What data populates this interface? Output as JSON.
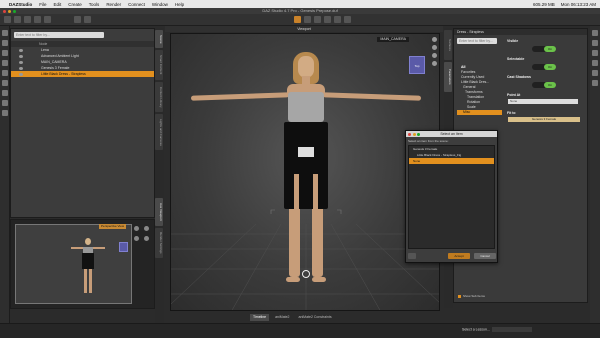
{
  "menubar": {
    "app": "DAZStudio",
    "items": [
      "File",
      "Edit",
      "Create",
      "Tools",
      "Render",
      "Connect",
      "Window",
      "Help"
    ],
    "right_status": [
      "605.29 MB",
      "Mon 06:13:23 AM"
    ]
  },
  "window": {
    "title": "DAZ Studio 4.7 Pro - Genesis Prepose.duf"
  },
  "scene": {
    "filter_placeholder": "Enter text to filter by...",
    "column": "Node",
    "nodes": [
      "Lena",
      "Advanced Ambient Light",
      "MAIN_CAMERA",
      "Genesis 3 Female",
      "Little Black Dress - Strapless"
    ],
    "selected_index": 4
  },
  "left_tabs": [
    "Scene",
    "Smart Content",
    "Content Library",
    "Lights and Cameras"
  ],
  "aux": {
    "label": "Perspective View"
  },
  "aux_tabs": [
    "Aux Viewport",
    "Render Settings"
  ],
  "viewport": {
    "title": "Viewport",
    "camera": "MAIN_CAMERA",
    "cube_label": "Top"
  },
  "right_tabs": [
    "Surfaces",
    "Parameters"
  ],
  "params": {
    "header": "Dress - Strapless",
    "filter_placeholder": "Enter text to filter by...",
    "list": [
      "All",
      "Favorites",
      "Currently Used",
      "Little Black Dres...",
      "General",
      "Transforms",
      "Translation",
      "Rotation",
      "Scale",
      "Misc"
    ],
    "selected_index": 9,
    "props": [
      {
        "name": "Visible",
        "value": "On"
      },
      {
        "name": "Selectable",
        "value": "On"
      },
      {
        "name": "Cast Shadows",
        "value": "On"
      },
      {
        "name": "Point At",
        "value": "None"
      },
      {
        "name": "Fit to",
        "value": "Genesis 3 Female"
      }
    ],
    "show_sub": "Show Sub Items"
  },
  "dialog": {
    "title": "Select an Item",
    "message": "Select an item from the scene:",
    "items": [
      "Genesis 3 Female",
      "Little Black Dress - Strapless_Fig",
      "None"
    ],
    "selected_index": 2,
    "accept": "Accept",
    "cancel": "Cancel"
  },
  "bottom_tabs": [
    "Timeline",
    "aniMate2",
    "aniMate2 Constraints"
  ],
  "status": {
    "lesson": "Select a Lesson..."
  }
}
